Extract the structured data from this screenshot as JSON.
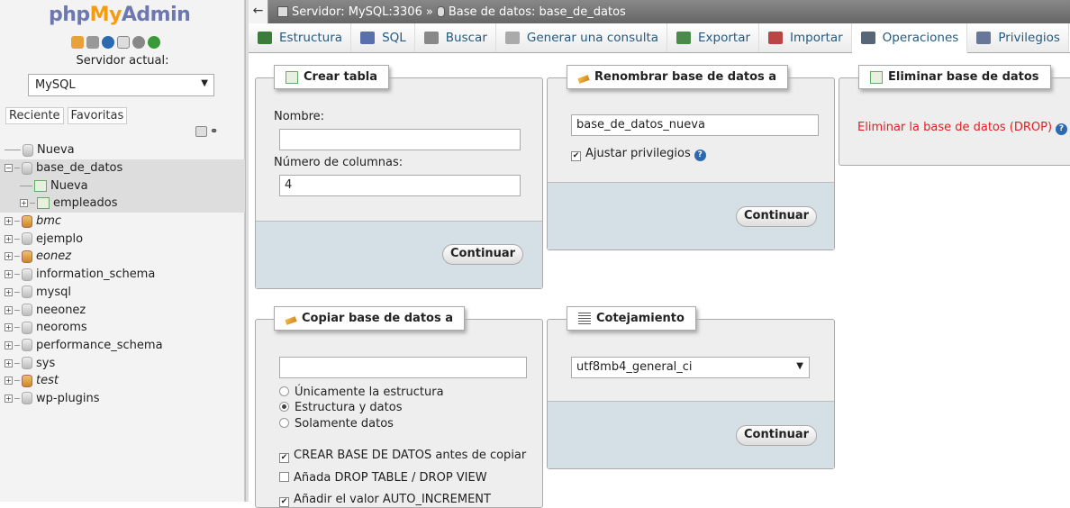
{
  "logo": {
    "part1": "php",
    "part2": "My",
    "part3": "Admin"
  },
  "sidebar": {
    "server_label": "Servidor actual:",
    "server_value": "MySQL",
    "tab_recent": "Reciente",
    "tab_fav": "Favoritas",
    "tree": [
      {
        "label": "Nueva",
        "type": "new",
        "indent": 0
      },
      {
        "label": "base_de_datos",
        "type": "db",
        "indent": 0,
        "expanded": true,
        "selected": true
      },
      {
        "label": "Nueva",
        "type": "newtable",
        "indent": 1,
        "selected": true
      },
      {
        "label": "empleados",
        "type": "table",
        "indent": 1,
        "selected": true
      },
      {
        "label": "bmc",
        "type": "db-star",
        "indent": 0,
        "italic": true
      },
      {
        "label": "ejemplo",
        "type": "db",
        "indent": 0
      },
      {
        "label": "eonez",
        "type": "db-star",
        "indent": 0,
        "italic": true
      },
      {
        "label": "information_schema",
        "type": "db",
        "indent": 0
      },
      {
        "label": "mysql",
        "type": "db",
        "indent": 0
      },
      {
        "label": "neeonez",
        "type": "db",
        "indent": 0
      },
      {
        "label": "neoroms",
        "type": "db",
        "indent": 0
      },
      {
        "label": "performance_schema",
        "type": "db",
        "indent": 0
      },
      {
        "label": "sys",
        "type": "db",
        "indent": 0
      },
      {
        "label": "test",
        "type": "db-star",
        "indent": 0,
        "italic": true
      },
      {
        "label": "wp-plugins",
        "type": "db",
        "indent": 0
      }
    ]
  },
  "topbar": {
    "back": "←",
    "server": "Servidor: MySQL:3306",
    "sep": "»",
    "db": "Base de datos: base_de_datos"
  },
  "menu": [
    {
      "label": "Estructura",
      "icon": "structure-icon",
      "color": "#3a7d3a"
    },
    {
      "label": "SQL",
      "icon": "sql-icon",
      "color": "#5a6fae"
    },
    {
      "label": "Buscar",
      "icon": "search-icon",
      "color": "#888"
    },
    {
      "label": "Generar una consulta",
      "icon": "query-icon",
      "color": "#aaa"
    },
    {
      "label": "Exportar",
      "icon": "export-icon",
      "color": "#4a8a4a"
    },
    {
      "label": "Importar",
      "icon": "import-icon",
      "color": "#b44"
    },
    {
      "label": "Operaciones",
      "icon": "wrench-icon",
      "color": "#567",
      "active": true
    },
    {
      "label": "Privilegios",
      "icon": "privileges-icon",
      "color": "#679"
    }
  ],
  "create_table": {
    "legend": "Crear tabla",
    "name_label": "Nombre:",
    "name_value": "",
    "cols_label": "Número de columnas:",
    "cols_value": "4",
    "button": "Continuar"
  },
  "rename_db": {
    "legend": "Renombrar base de datos a",
    "value": "base_de_datos_nueva",
    "adjust": "Ajustar privilegios",
    "button": "Continuar"
  },
  "drop_db": {
    "legend": "Eliminar base de datos",
    "link": "Eliminar la base de datos (DROP)"
  },
  "copy_db": {
    "legend": "Copiar base de datos a",
    "value": "",
    "radio1": "Únicamente la estructura",
    "radio2": "Estructura y datos",
    "radio3": "Solamente datos",
    "check1": "CREAR BASE DE DATOS antes de copiar",
    "check2": "Añada DROP TABLE / DROP VIEW",
    "check3": "Añadir el valor AUTO_INCREMENT"
  },
  "collation": {
    "legend": "Cotejamiento",
    "value": "utf8mb4_general_ci",
    "button": "Continuar"
  }
}
